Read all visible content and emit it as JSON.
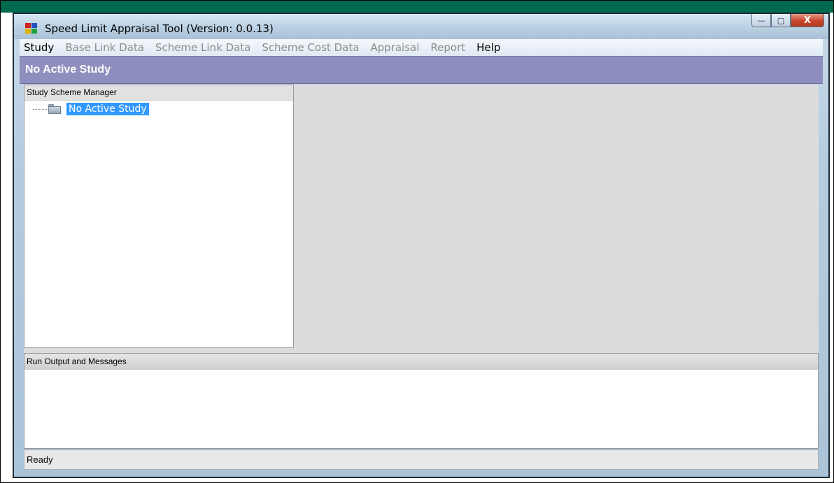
{
  "window": {
    "title": "Speed Limit Appraisal Tool  (Version: 0.0.13)",
    "buttons": {
      "minimize": "—",
      "maximize": "▢",
      "close": "X"
    }
  },
  "menu": {
    "items": [
      {
        "label": "Study",
        "enabled": true
      },
      {
        "label": "Base Link Data",
        "enabled": false
      },
      {
        "label": "Scheme Link Data",
        "enabled": false
      },
      {
        "label": "Scheme Cost Data",
        "enabled": false
      },
      {
        "label": "Appraisal",
        "enabled": false
      },
      {
        "label": "Report",
        "enabled": false
      },
      {
        "label": "Help",
        "enabled": true
      }
    ]
  },
  "study_header": {
    "title": "No Active Study"
  },
  "scheme_manager": {
    "header": "Study Scheme Manager",
    "tree": [
      {
        "label": "No Active Study",
        "icon": "folder-icon",
        "selected": true
      }
    ]
  },
  "output": {
    "header": "Run Output and Messages"
  },
  "status": {
    "text": "Ready"
  },
  "colors": {
    "accent_band": "#006a4e",
    "study_header_bg": "#8f8fbf",
    "selection": "#3399ff",
    "close_button": "#c8452d"
  }
}
